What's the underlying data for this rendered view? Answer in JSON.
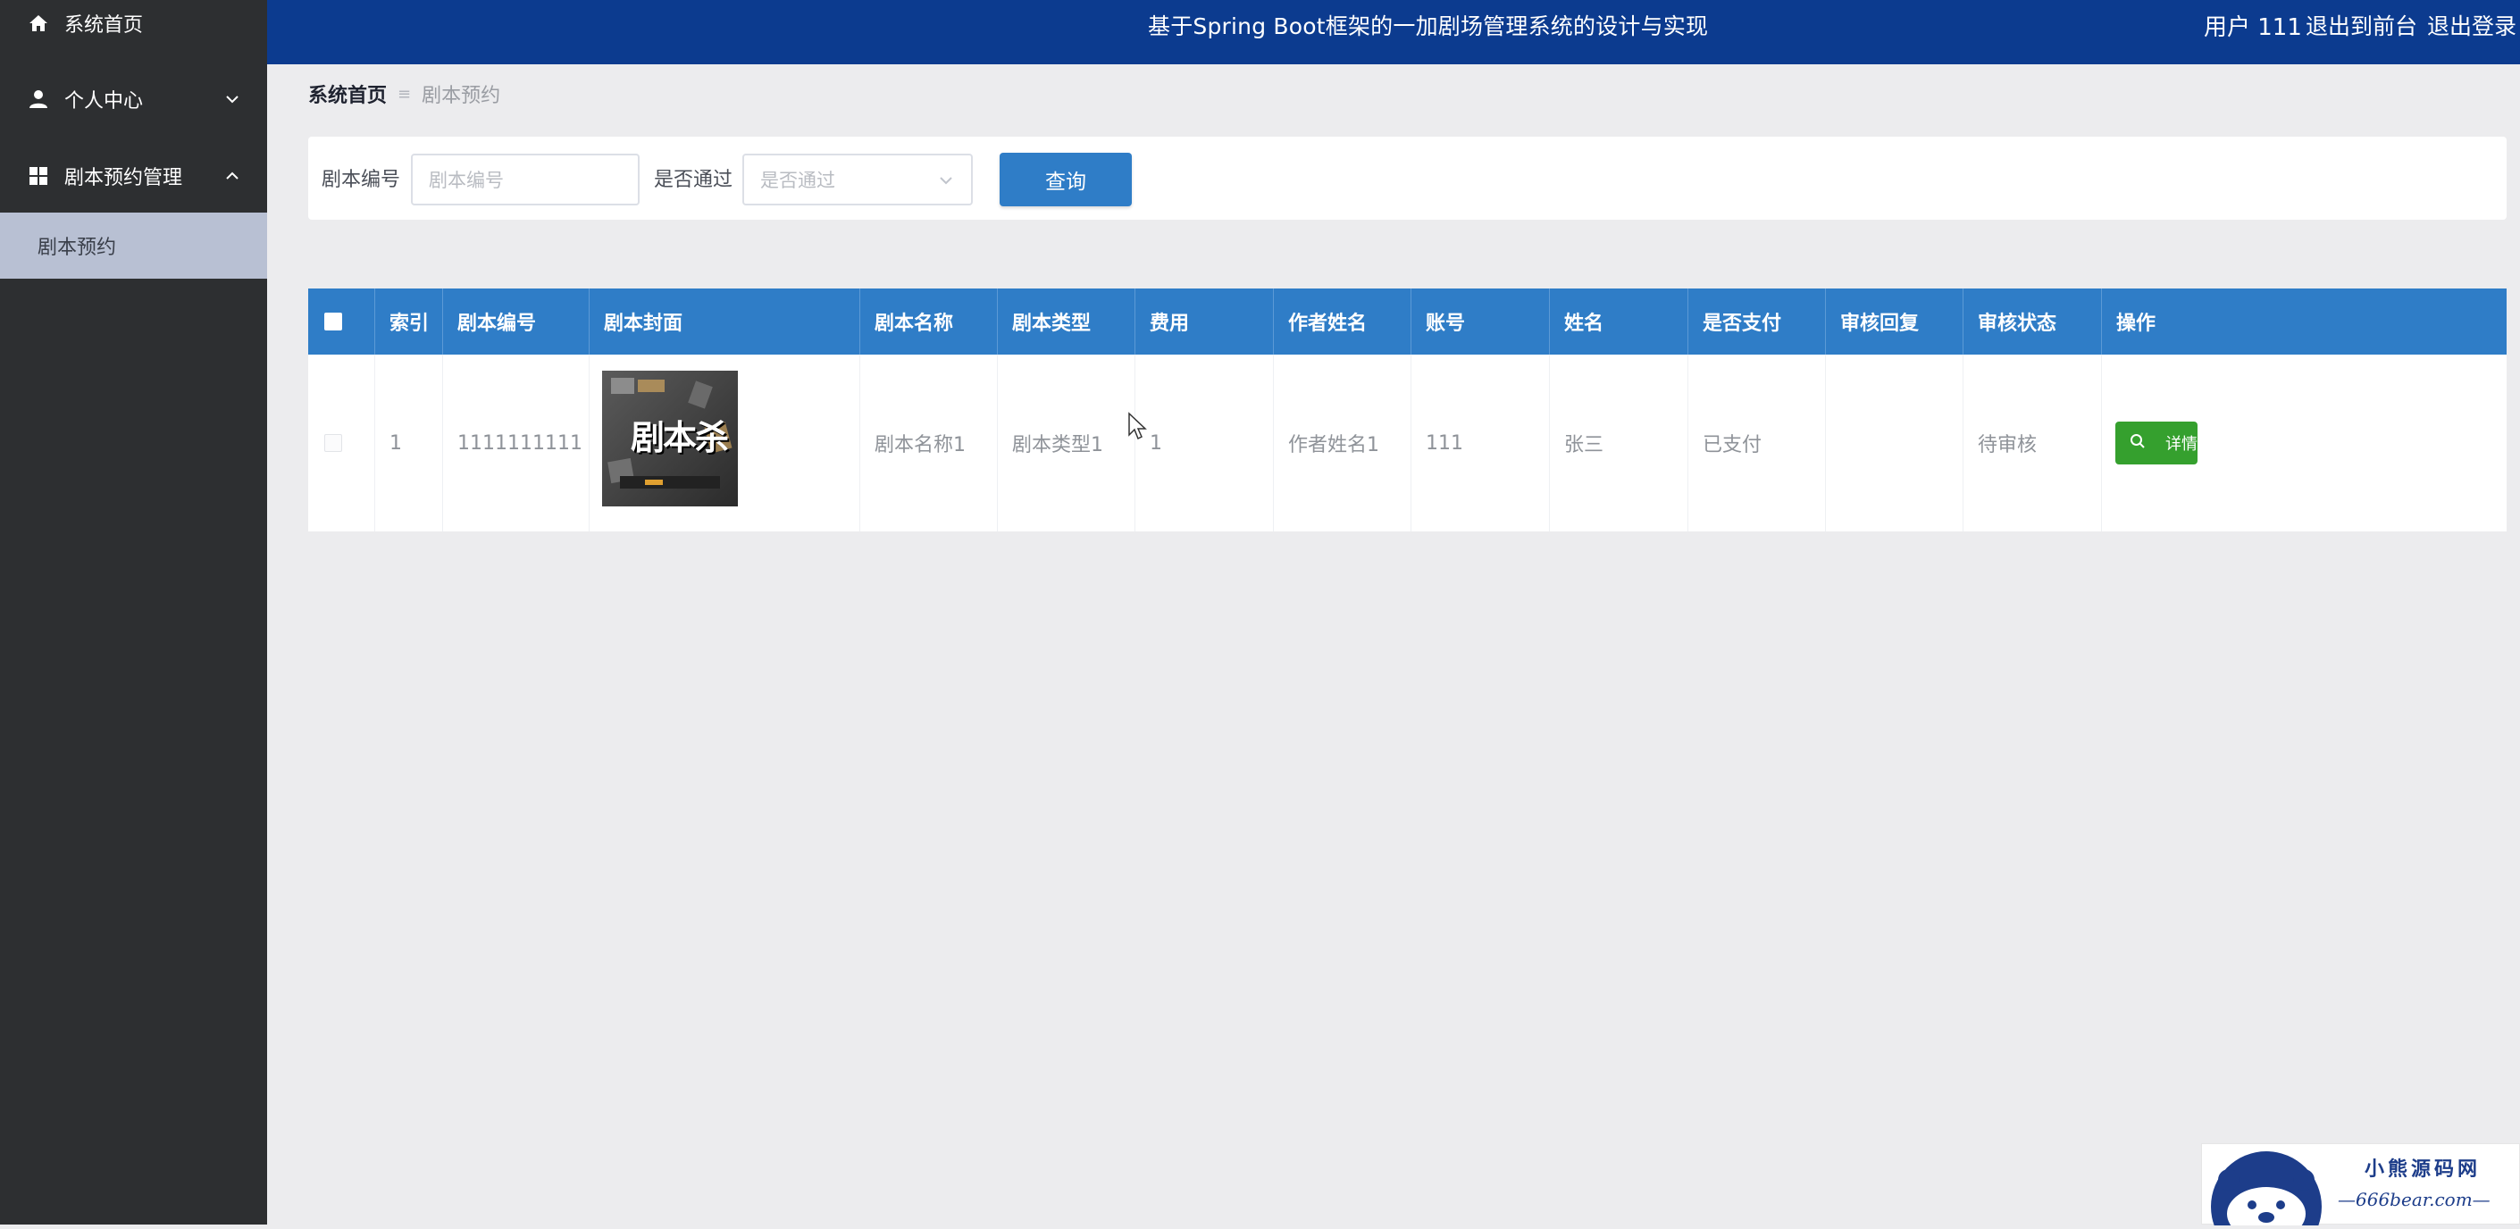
{
  "sidebar": {
    "items": [
      {
        "icon": "home-icon",
        "label": "系统首页"
      },
      {
        "icon": "user-icon",
        "label": "个人中心"
      },
      {
        "icon": "grid-icon",
        "label": "剧本预约管理"
      }
    ],
    "sub_items": [
      {
        "label": "剧本预约"
      }
    ]
  },
  "header": {
    "title": "基于Spring Boot框架的一加剧场管理系统的设计与实现",
    "user": "用户 111",
    "to_front": "退出到前台",
    "logout": "退出登录"
  },
  "breadcrumb": {
    "home": "系统首页",
    "current": "剧本预约"
  },
  "search": {
    "script_no_label": "剧本编号",
    "script_no_placeholder": "剧本编号",
    "passed_label": "是否通过",
    "passed_placeholder": "是否通过",
    "query_button": "查询"
  },
  "table": {
    "headers": [
      "索引",
      "剧本编号",
      "剧本封面",
      "剧本名称",
      "剧本类型",
      "费用",
      "作者姓名",
      "账号",
      "姓名",
      "是否支付",
      "审核回复",
      "审核状态",
      "操作"
    ],
    "rows": [
      {
        "index": "1",
        "script_no": "1111111111",
        "cover_text": "剧本杀",
        "name": "剧本名称1",
        "type": "剧本类型1",
        "fee": "1",
        "author": "作者姓名1",
        "account": "111",
        "real_name": "张三",
        "paid": "已支付",
        "review_reply": "",
        "review_status": "待审核",
        "action": "详情"
      }
    ]
  },
  "watermark": {
    "cn": "小熊源码网",
    "en": "—666bear.com—"
  },
  "colors": {
    "header": "#0c3b8f",
    "sidebar": "#2d2f31",
    "table_header": "#2f7dc7",
    "detail_button": "#35a02e"
  }
}
